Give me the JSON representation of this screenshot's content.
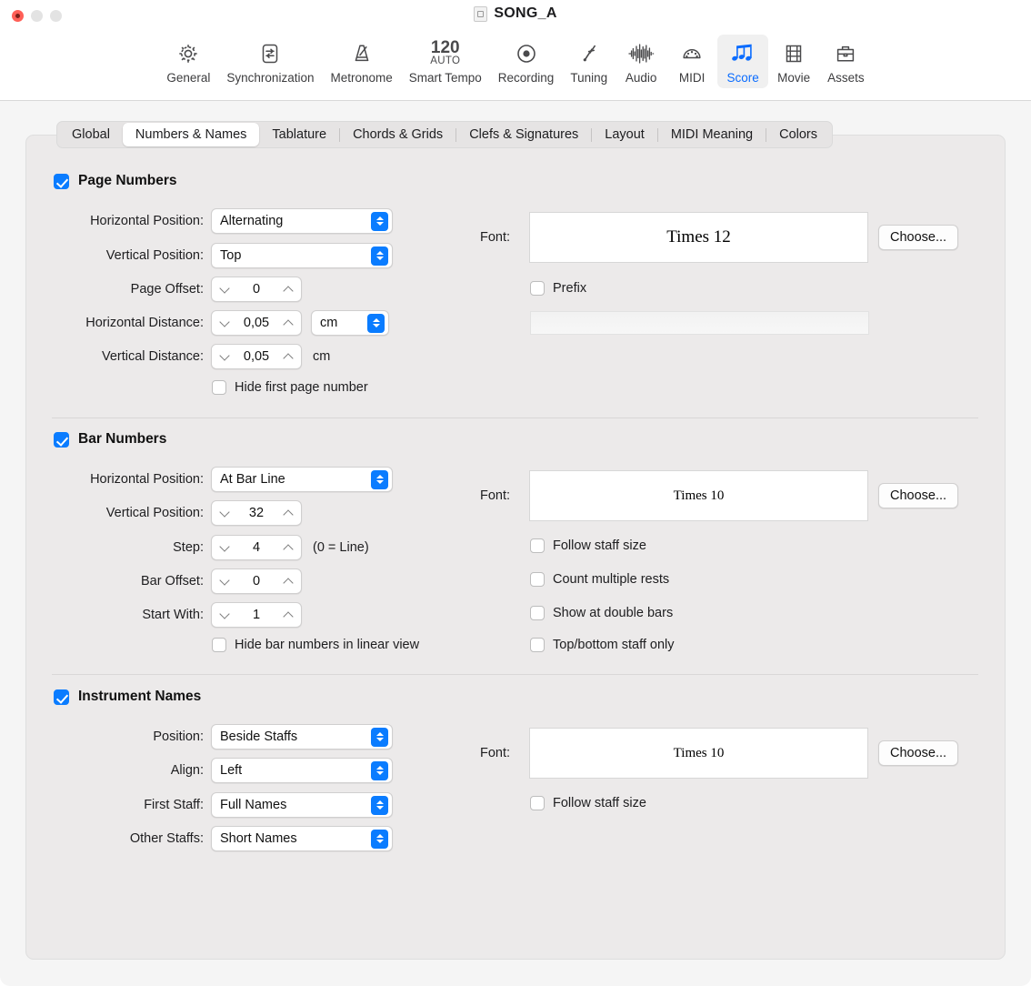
{
  "window": {
    "title": "SONG_A",
    "doc_icon": "document-icon",
    "traffic_lights": [
      "close",
      "minimize",
      "maximize"
    ]
  },
  "toolbar": {
    "items": [
      {
        "label": "General",
        "icon": "gear-icon",
        "selected": false
      },
      {
        "label": "Synchronization",
        "icon": "sync-arrows-icon",
        "selected": false
      },
      {
        "label": "Metronome",
        "icon": "metronome-icon",
        "selected": false
      },
      {
        "label": "Smart Tempo",
        "icon": "tempo-120-auto-icon",
        "selected": false,
        "tempo": "120",
        "tempo_mode": "AUTO"
      },
      {
        "label": "Recording",
        "icon": "record-circle-icon",
        "selected": false
      },
      {
        "label": "Tuning",
        "icon": "tuning-fork-icon",
        "selected": false
      },
      {
        "label": "Audio",
        "icon": "waveform-icon",
        "selected": false
      },
      {
        "label": "MIDI",
        "icon": "midi-connector-icon",
        "selected": false
      },
      {
        "label": "Score",
        "icon": "music-notes-icon",
        "selected": true
      },
      {
        "label": "Movie",
        "icon": "film-strip-icon",
        "selected": false
      },
      {
        "label": "Assets",
        "icon": "briefcase-icon",
        "selected": false
      }
    ],
    "accent_color": "#0a6cff"
  },
  "tabs": [
    {
      "label": "Global",
      "active": false
    },
    {
      "label": "Numbers & Names",
      "active": true
    },
    {
      "label": "Tablature",
      "active": false
    },
    {
      "label": "Chords & Grids",
      "active": false
    },
    {
      "label": "Clefs & Signatures",
      "active": false
    },
    {
      "label": "Layout",
      "active": false
    },
    {
      "label": "MIDI Meaning",
      "active": false
    },
    {
      "label": "Colors",
      "active": false
    }
  ],
  "page_numbers": {
    "title": "Page Numbers",
    "enabled": true,
    "horizontal_position_label": "Horizontal Position:",
    "horizontal_position_value": "Alternating",
    "vertical_position_label": "Vertical Position:",
    "vertical_position_value": "Top",
    "page_offset_label": "Page Offset:",
    "page_offset_value": "0",
    "horizontal_distance_label": "Horizontal Distance:",
    "horizontal_distance_value": "0,05",
    "horizontal_distance_unit": "cm",
    "vertical_distance_label": "Vertical Distance:",
    "vertical_distance_value": "0,05",
    "vertical_distance_unit": "cm",
    "hide_first_page_number_label": "Hide first page number",
    "hide_first_page_number_checked": false,
    "font_label": "Font:",
    "font_value": "Times 12",
    "choose_label": "Choose...",
    "prefix_label": "Prefix",
    "prefix_checked": false,
    "prefix_value": "",
    "prefix_placeholder": ""
  },
  "bar_numbers": {
    "title": "Bar Numbers",
    "enabled": true,
    "horizontal_position_label": "Horizontal Position:",
    "horizontal_position_value": "At Bar Line",
    "vertical_position_label": "Vertical Position:",
    "vertical_position_value": "32",
    "step_label": "Step:",
    "step_value": "4",
    "step_hint": "(0 = Line)",
    "bar_offset_label": "Bar Offset:",
    "bar_offset_value": "0",
    "start_with_label": "Start With:",
    "start_with_value": "1",
    "hide_linear_label": "Hide bar numbers in linear view",
    "hide_linear_checked": false,
    "font_label": "Font:",
    "font_value": "Times 10",
    "choose_label": "Choose...",
    "options": [
      {
        "label": "Follow staff size",
        "checked": false
      },
      {
        "label": "Count multiple rests",
        "checked": false
      },
      {
        "label": "Show at double bars",
        "checked": false
      },
      {
        "label": "Top/bottom staff only",
        "checked": false
      }
    ]
  },
  "instrument_names": {
    "title": "Instrument Names",
    "enabled": true,
    "position_label": "Position:",
    "position_value": "Beside Staffs",
    "align_label": "Align:",
    "align_value": "Left",
    "first_staff_label": "First Staff:",
    "first_staff_value": "Full Names",
    "other_staffs_label": "Other Staffs:",
    "other_staffs_value": "Short Names",
    "font_label": "Font:",
    "font_value": "Times 10",
    "choose_label": "Choose...",
    "follow_staff_size_label": "Follow staff size",
    "follow_staff_size_checked": false
  }
}
